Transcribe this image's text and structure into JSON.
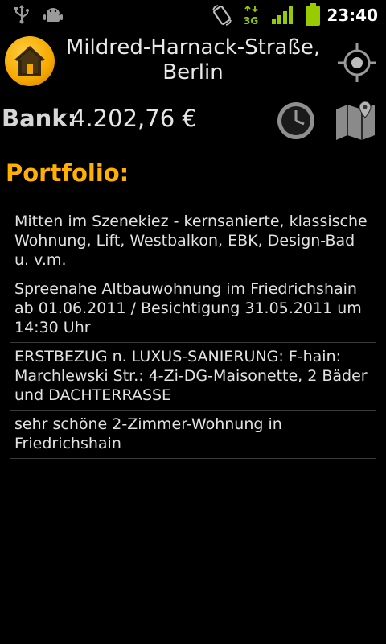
{
  "status_bar": {
    "time": "23:40",
    "icons": [
      "usb-icon",
      "android-debug-icon",
      "rotation-icon",
      "3g-icon",
      "signal-icon",
      "battery-icon"
    ],
    "network_label": "3G",
    "accent": "#99cc00"
  },
  "header": {
    "location": "Mildred-Harnack-Straße, Berlin",
    "home_icon": "house-icon",
    "locate_icon": "crosshair-icon"
  },
  "bank": {
    "label": "Bank:",
    "value": "4.202,76 €",
    "clock_icon": "clock-icon",
    "map_icon": "map-icon"
  },
  "portfolio": {
    "title": "Portfolio:",
    "items": [
      "Mitten im Szenekiez - kernsanierte, klassische Wohnung, Lift, Westbalkon, EBK, Design-Bad u. v.m.",
      "Spreenahe Altbauwohnung im Friedrichshain ab 01.06.2011 / Besichtigung 31.05.2011 um 14:30 Uhr",
      "ERSTBEZUG n. LUXUS-SANIERUNG: F-hain: Marchlewski Str.: 4-Zi-DG-Maisonette, 2 Bäder und DACHTERRASSE",
      "sehr schöne 2-Zimmer-Wohnung in Friedrichshain"
    ]
  },
  "colors": {
    "accent": "#ffb000",
    "background": "#000000"
  }
}
